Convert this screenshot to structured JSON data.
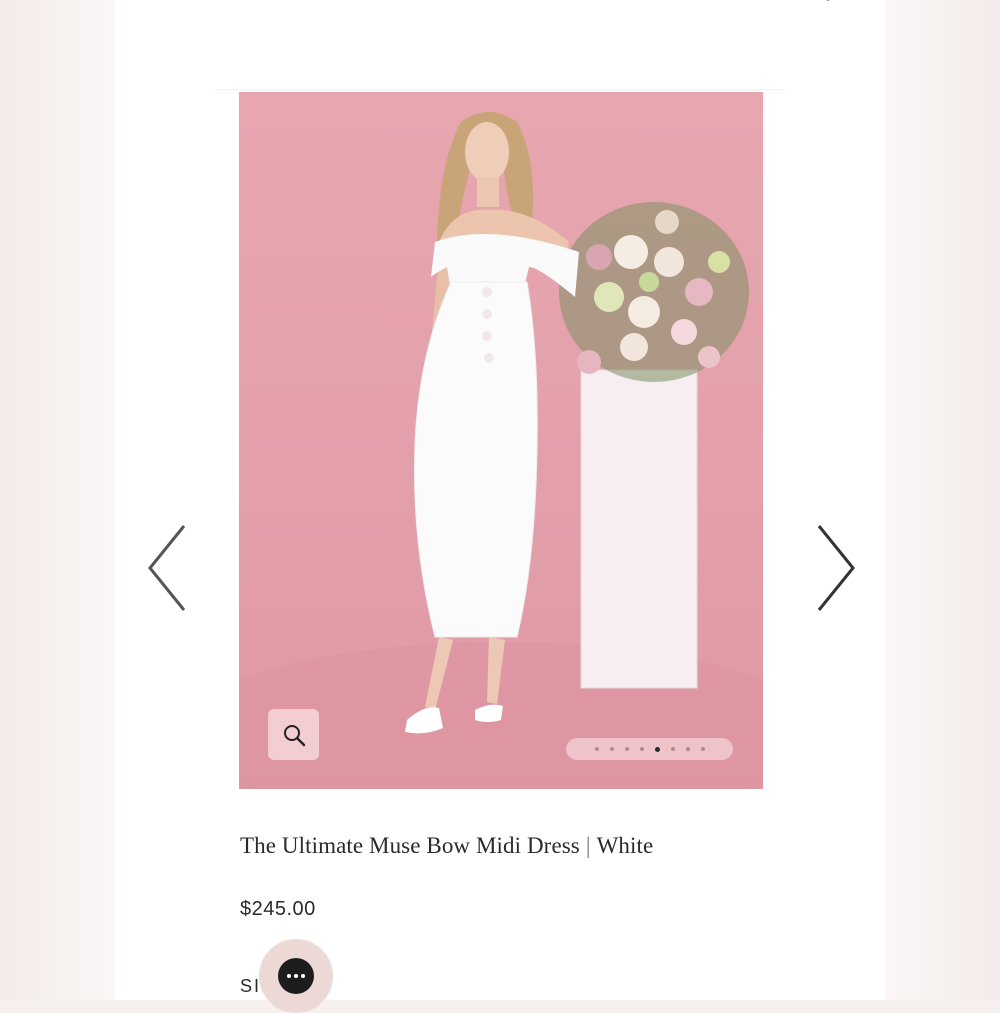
{
  "product": {
    "name": "The Ultimate Muse Bow Midi Dress",
    "variant": "White",
    "separator": "|",
    "price": "$245.00"
  },
  "gallery": {
    "slide_count": 8,
    "active_slide": 5,
    "image_description_icon": "product-photo"
  },
  "options": {
    "size_label_visible": "SI",
    "size_label_tail": "S"
  },
  "icons": {
    "zoom": "magnifier-icon",
    "prev": "chevron-left-icon",
    "next": "chevron-right-icon",
    "chat": "chat-bubble-icon",
    "close": "close-icon"
  },
  "colors": {
    "background_pink": "#e5a3ad",
    "text": "#2a2a2a"
  }
}
